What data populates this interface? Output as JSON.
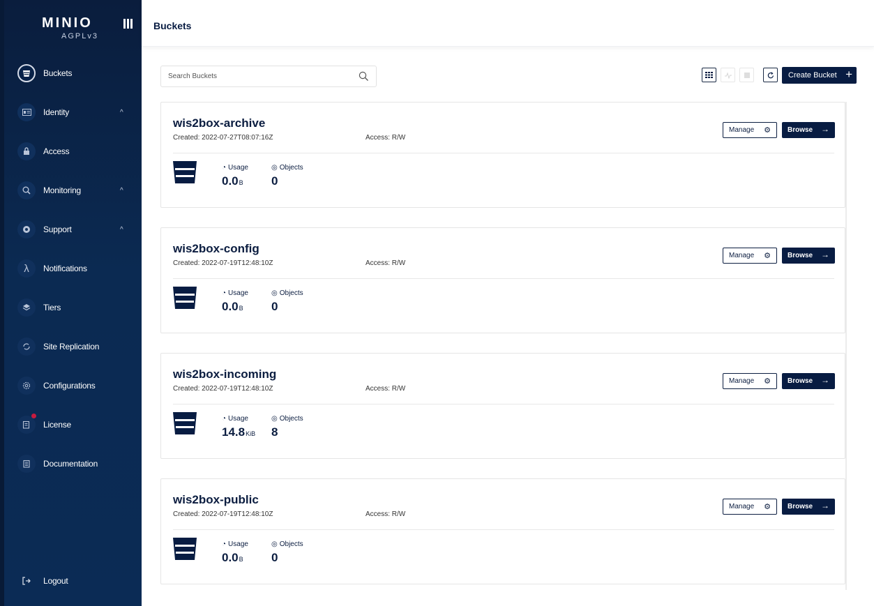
{
  "app": {
    "logo_text": "MINIO",
    "license": "AGPLv3"
  },
  "sidebar": {
    "items": [
      {
        "label": "Buckets",
        "icon": "bucket-icon",
        "active": true
      },
      {
        "label": "Identity",
        "icon": "id-card-icon",
        "caret": "^"
      },
      {
        "label": "Access",
        "icon": "lock-icon"
      },
      {
        "label": "Monitoring",
        "icon": "monitoring-icon",
        "caret": "^"
      },
      {
        "label": "Support",
        "icon": "support-icon",
        "caret": "^"
      },
      {
        "label": "Notifications",
        "icon": "lambda-icon"
      },
      {
        "label": "Tiers",
        "icon": "layers-icon"
      },
      {
        "label": "Site Replication",
        "icon": "replication-icon"
      },
      {
        "label": "Configurations",
        "icon": "gear-icon"
      },
      {
        "label": "License",
        "icon": "license-icon"
      },
      {
        "label": "Documentation",
        "icon": "documentation-icon"
      }
    ],
    "logout": "Logout"
  },
  "header": {
    "title": "Buckets"
  },
  "toolbar": {
    "search_placeholder": "Search Buckets",
    "create_label": "Create Bucket",
    "create_icon": "+"
  },
  "buckets": [
    {
      "name": "wis2box-archive",
      "created": "Created: 2022-07-27T08:07:16Z",
      "access": "Access: R/W",
      "usage_label": "Usage",
      "objects_label": "Objects",
      "usage_value": "0.0",
      "usage_unit": "B",
      "objects_value": "0",
      "manage": "Manage",
      "browse": "Browse"
    },
    {
      "name": "wis2box-config",
      "created": "Created: 2022-07-19T12:48:10Z",
      "access": "Access: R/W",
      "usage_label": "Usage",
      "objects_label": "Objects",
      "usage_value": "0.0",
      "usage_unit": "B",
      "objects_value": "0",
      "manage": "Manage",
      "browse": "Browse"
    },
    {
      "name": "wis2box-incoming",
      "created": "Created: 2022-07-19T12:48:10Z",
      "access": "Access: R/W",
      "usage_label": "Usage",
      "objects_label": "Objects",
      "usage_value": "14.8",
      "usage_unit": "KiB",
      "objects_value": "8",
      "manage": "Manage",
      "browse": "Browse"
    },
    {
      "name": "wis2box-public",
      "created": "Created: 2022-07-19T12:48:10Z",
      "access": "Access: R/W",
      "usage_label": "Usage",
      "objects_label": "Objects",
      "usage_value": "0.0",
      "usage_unit": "B",
      "objects_value": "0",
      "manage": "Manage",
      "browse": "Browse"
    }
  ],
  "colors": {
    "sidebar_bg": "#0b2a52",
    "primary": "#081c42",
    "notification_dot": "#c51b3f"
  }
}
